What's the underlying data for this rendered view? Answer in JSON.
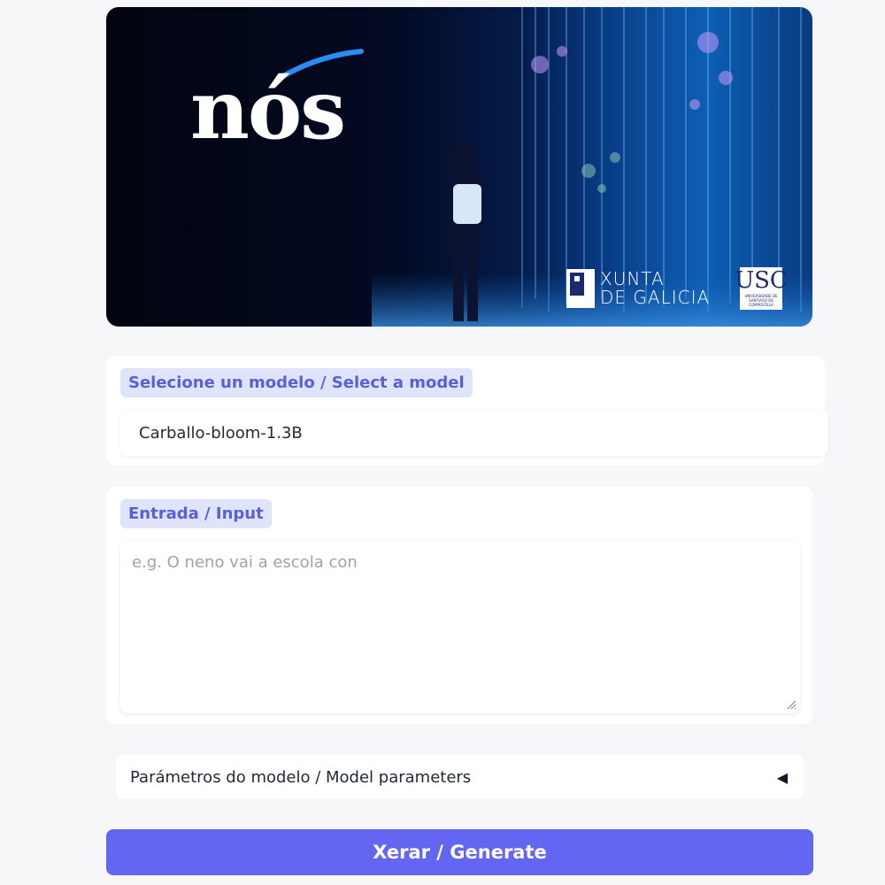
{
  "banner": {
    "logo": "nós",
    "sponsor1_line1": "XUNTA",
    "sponsor1_line2": "DE GALICIA",
    "sponsor2": "USC",
    "sponsor2_sub": "UNIVERSIDADE DE SANTIAGO DE COMPOSTELA"
  },
  "model": {
    "label": "Selecione un modelo / Select a model",
    "selected": "Carballo-bloom-1.3B"
  },
  "input": {
    "label": "Entrada / Input",
    "placeholder": "e.g. O neno vai a escola con",
    "value": ""
  },
  "params": {
    "label": "Parámetros do modelo / Model parameters",
    "caret": "◀"
  },
  "generate": {
    "label": "Xerar / Generate"
  },
  "colors": {
    "accent": "#6366f1",
    "chip_bg": "#e0e4fb",
    "chip_text": "#5a5fd6",
    "page_bg": "#f6f7f9"
  }
}
